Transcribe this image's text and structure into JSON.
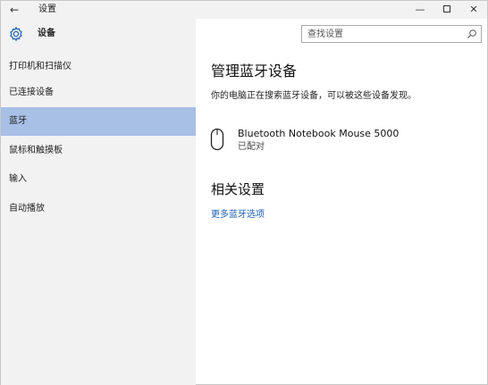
{
  "window": {
    "title": "设置",
    "back_icon": "back-arrow-icon",
    "controls": {
      "minimize_icon": "minimize-icon",
      "maximize_icon": "maximize-icon",
      "close_icon": "close-icon"
    }
  },
  "sidebar": {
    "header_icon": "gear-icon",
    "header_title": "设备",
    "items": [
      {
        "label": "打印机和扫描仪",
        "selected": false
      },
      {
        "label": "已连接设备",
        "selected": false
      },
      {
        "label": "蓝牙",
        "selected": true
      },
      {
        "label": "鼠标和触摸板",
        "selected": false
      },
      {
        "label": "输入",
        "selected": false
      },
      {
        "label": "自动播放",
        "selected": false
      }
    ],
    "selected_color": "#a8bfe6",
    "background_color": "#f2f2f2"
  },
  "search": {
    "placeholder": "查找设置",
    "value": "",
    "icon": "search-icon"
  },
  "main": {
    "title": "管理蓝牙设备",
    "description": "你的电脑正在搜索蓝牙设备，可以被这些设备发现。",
    "devices": [
      {
        "icon": "mouse-icon",
        "name": "Bluetooth Notebook Mouse 5000",
        "status": "已配对"
      }
    ],
    "related_title": "相关设置",
    "related_link": "更多蓝牙选项",
    "link_color": "#1a5fb4"
  }
}
